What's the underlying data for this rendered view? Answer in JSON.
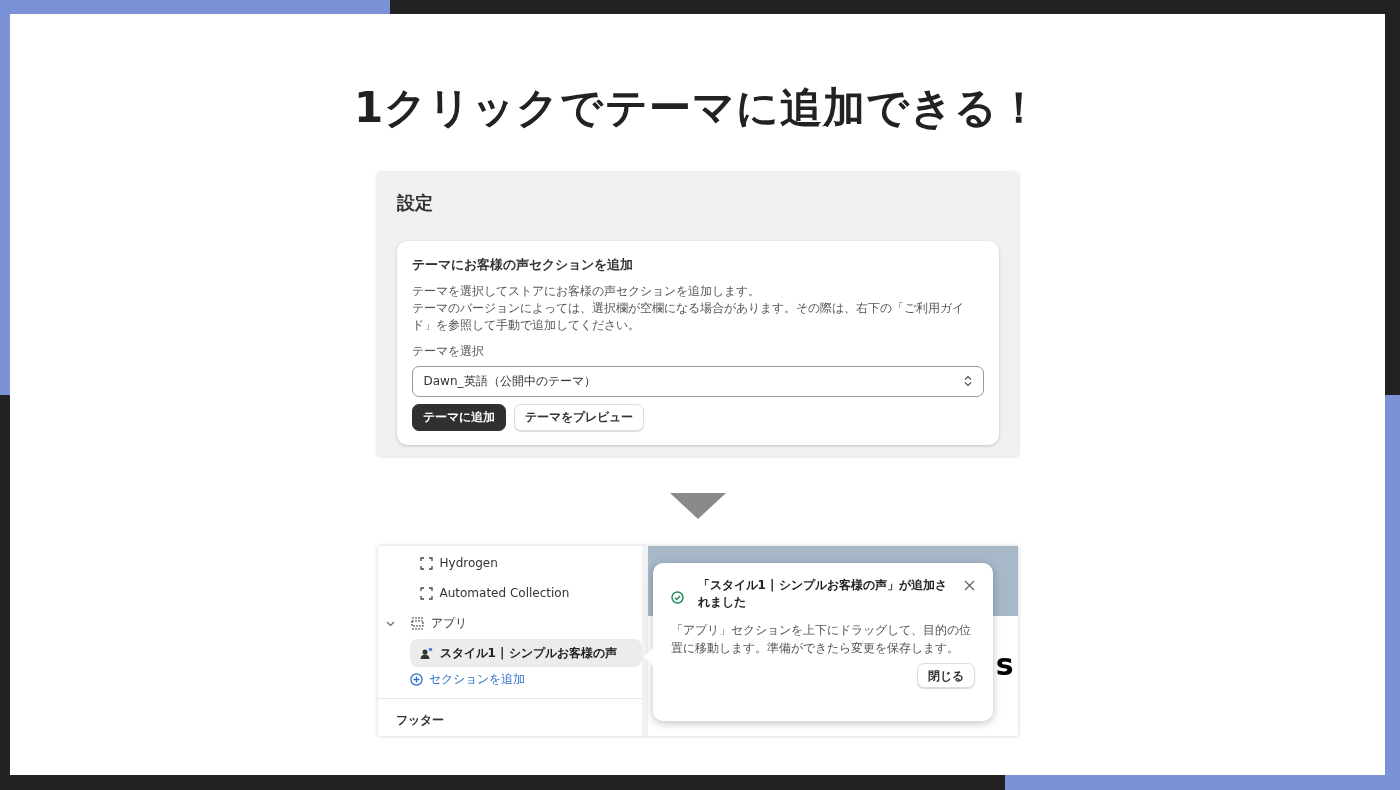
{
  "title": "1クリックでテーマに追加できる！",
  "settings": {
    "heading": "設定",
    "card": {
      "title": "テーマにお客様の声セクションを追加",
      "description": [
        "テーマを選択してストアにお客様の声セクションを追加します。",
        "テーマのバージョンによっては、選択欄が空欄になる場合があります。その際は、右下の「ご利用ガイド」を参照して手動で追加してください。"
      ],
      "select": {
        "label": "テーマを選択",
        "value": "Dawn_英語（公開中のテーマ）"
      },
      "buttons": [
        {
          "label": "テーマに追加",
          "kind": "primary"
        },
        {
          "label": "テーマをプレビュー",
          "kind": "secondary"
        }
      ]
    }
  },
  "editor": {
    "sidebar": {
      "items": [
        {
          "label": "Hydrogen",
          "kind": "section",
          "selected": false
        },
        {
          "label": "Automated Collection",
          "kind": "section",
          "selected": false
        },
        {
          "label": "アプリ",
          "kind": "group",
          "selected": false,
          "expanded": true,
          "children": [
            {
              "label": "スタイル1 | シンプルお客様の声",
              "kind": "app",
              "selected": true
            }
          ]
        }
      ],
      "add_section": "セクションを追加",
      "footer_heading": "フッター"
    },
    "preview": {
      "text_fragment": "s"
    },
    "toast": {
      "title": "「スタイル1 | シンプルお客様の声」が追加されました",
      "message": "「アプリ」セクションを上下にドラッグして、目的の位置に移動します。準備ができたら変更を保存します。",
      "close_button": "閉じる"
    }
  }
}
